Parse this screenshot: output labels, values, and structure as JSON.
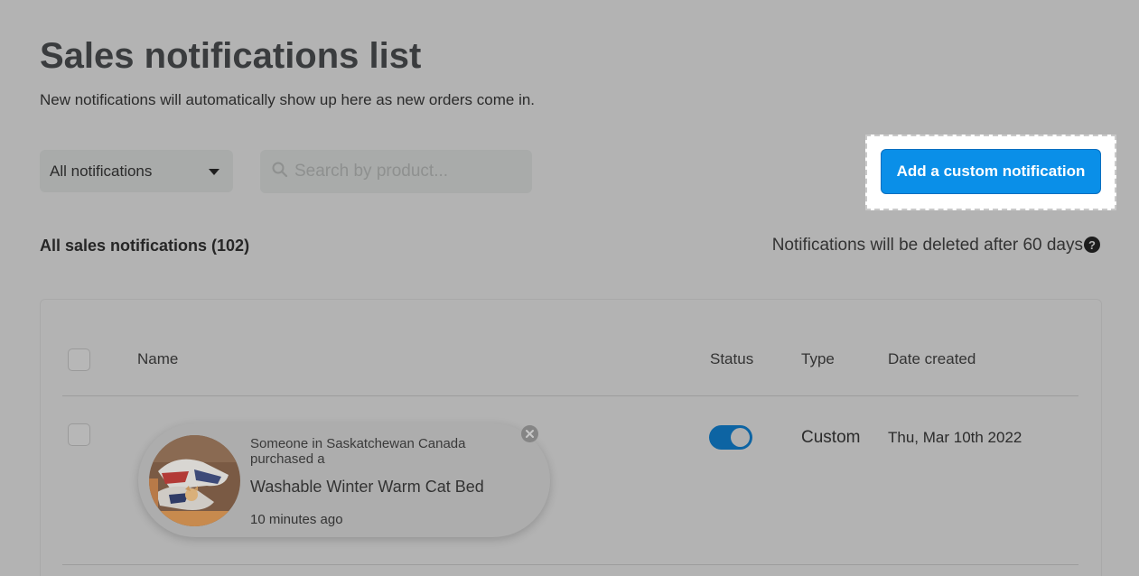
{
  "header": {
    "title": "Sales notifications list",
    "subtitle": "New notifications will automatically show up here as new orders come in."
  },
  "toolbar": {
    "filter_value": "All notifications",
    "search_placeholder": "Search by product...",
    "add_button_label": "Add a custom notification"
  },
  "list": {
    "heading": "All sales notifications (102)",
    "retention_note": "Notifications will be deleted after 60 days",
    "help_glyph": "?",
    "columns": [
      "Name",
      "Status",
      "Type",
      "Date created"
    ],
    "rows": [
      {
        "preview": {
          "location_line": "Someone in Saskatchewan Canada",
          "action_line": "purchased a",
          "product": "Washable Winter Warm Cat Bed",
          "time_ago": "10 minutes ago"
        },
        "status_enabled": true,
        "type": "Custom",
        "date_created": "Thu, Mar 10th 2022"
      }
    ]
  },
  "colors": {
    "accent": "#0a8fe8",
    "toggle_on": "#0d64a3",
    "overlay_background": "#b3b3b3"
  },
  "icons": [
    "chevron-down-icon",
    "search-icon",
    "help-icon",
    "close-icon"
  ]
}
